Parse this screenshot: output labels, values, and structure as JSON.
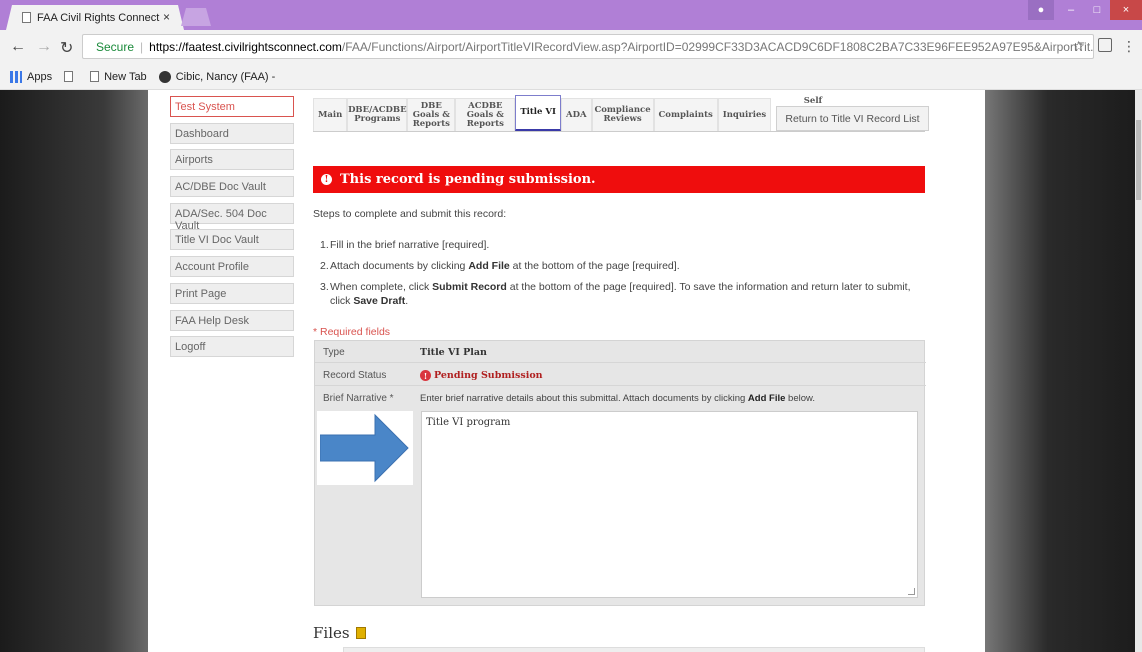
{
  "browser": {
    "tab_title": "FAA Civil Rights Connect",
    "tab_close": "×",
    "window_min": "–",
    "window_max": "□",
    "window_close": "×",
    "secure_label": "Secure",
    "url_host": "https://faatest.civilrightsconnect.com",
    "url_path": "/FAA/Functions/Airport/AirportTitleVIRecordView.asp?AirportID=02999CF33D3ACACD9C6DF1808C2BA7C33E96FEE952A97E95&AirportTit...",
    "bookmarks": [
      "Apps",
      "New Tab",
      "Cibic, Nancy (FAA) -"
    ]
  },
  "sidebar": {
    "items": [
      {
        "label": "Test System",
        "active": true
      },
      {
        "label": "Dashboard"
      },
      {
        "label": "Airports"
      },
      {
        "label": "AC/DBE Doc Vault"
      },
      {
        "label": "ADA/Sec. 504 Doc Vault"
      },
      {
        "label": "Title VI Doc Vault"
      },
      {
        "label": "Account Profile"
      },
      {
        "label": "Print Page"
      },
      {
        "label": "FAA Help Desk"
      },
      {
        "label": "Logoff"
      }
    ]
  },
  "tabs": [
    {
      "label": "Main"
    },
    {
      "label": "DBE/ACDBE Programs"
    },
    {
      "label": "DBE Goals & Reports"
    },
    {
      "label": "ACDBE Goals & Reports"
    },
    {
      "label": "Title VI",
      "active": true
    },
    {
      "label": "ADA"
    },
    {
      "label": "Compliance Reviews"
    },
    {
      "label": "Complaints"
    },
    {
      "label": "Inquiries"
    }
  ],
  "self_assessments_tab": "Self Assessments",
  "return_button": "Return to Title VI Record List",
  "alert": {
    "icon": "!",
    "text": "This record is pending submission."
  },
  "steps_intro": "Steps to complete and submit this record:",
  "steps": {
    "s1_num": "1.",
    "s1_text": "Fill in the brief narrative [required].",
    "s2_num": "2.",
    "s2_pre": "Attach documents by clicking ",
    "s2_bold": "Add File",
    "s2_post": " at the bottom of the page [required].",
    "s3_num": "3.",
    "s3_pre": "When complete, click ",
    "s3_bold": "Submit Record",
    "s3_mid": " at the bottom of the page [required]. To save the information and return later to submit, click ",
    "s3_bold2": "Save Draft",
    "s3_post": "."
  },
  "required_note": "* Required fields",
  "form": {
    "type_label": "Type",
    "type_value": "Title VI Plan",
    "status_label": "Record Status",
    "status_icon": "!",
    "status_value": "Pending Submission",
    "narrative_label": "Brief Narrative *",
    "narrative_hint_pre": "Enter brief narrative details about this submittal. Attach documents by clicking ",
    "narrative_hint_bold": "Add File",
    "narrative_hint_post": " below.",
    "narrative_value": "Title VI program"
  },
  "files_heading": "Files"
}
